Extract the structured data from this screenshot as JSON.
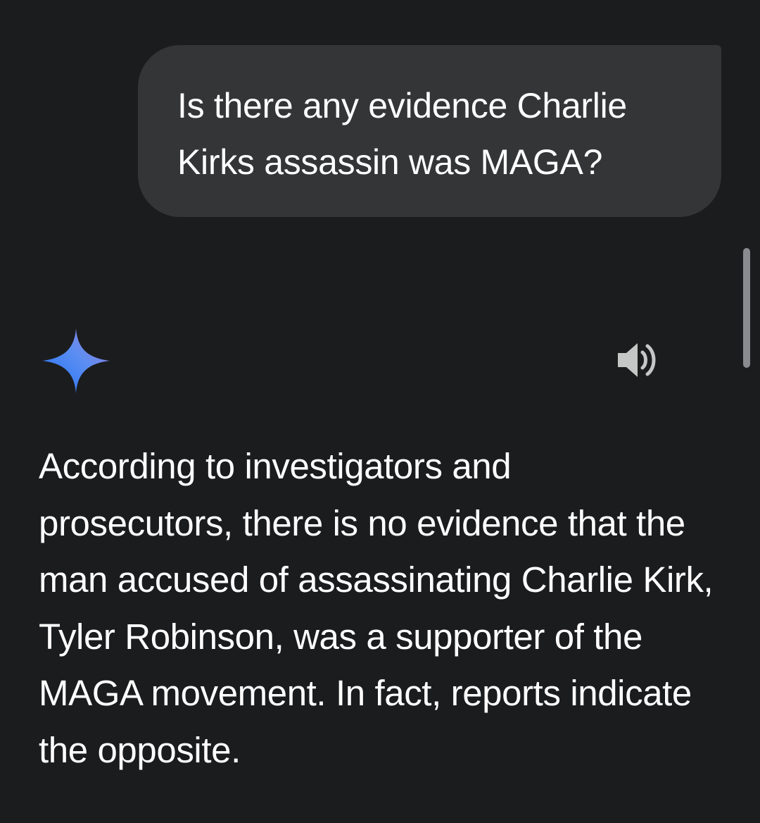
{
  "conversation": {
    "user_message": "Is there any evidence Charlie Kirks assassin was MAGA?",
    "assistant_message": "According to investigators and prosecutors, there is no evidence that the man accused of assassinating Charlie Kirk, Tyler Robinson, was a supporter of the MAGA movement. In fact, reports indicate the opposite."
  },
  "icons": {
    "assistant_avatar": "gemini-sparkle-icon",
    "read_aloud": "speaker-icon"
  },
  "colors": {
    "background": "#1b1c1e",
    "user_bubble": "#333537",
    "text": "#ffffff",
    "icon_gray": "#c4c7c5",
    "sparkle_start": "#4a8cf6",
    "sparkle_end": "#9b72cb"
  }
}
